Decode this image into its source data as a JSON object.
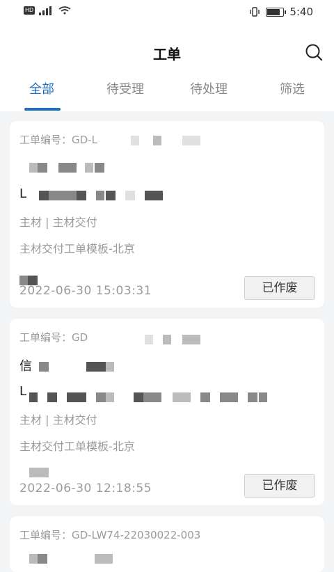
{
  "status_bar": {
    "network": "HD",
    "signal": "4G",
    "time": "5:40"
  },
  "header": {
    "title": "工单"
  },
  "tabs": [
    {
      "label": "全部",
      "active": true
    },
    {
      "label": "待受理",
      "active": false
    },
    {
      "label": "待处理",
      "active": false
    },
    {
      "label": "筛选",
      "active": false
    }
  ],
  "orders": [
    {
      "number": "工单编号：GD-L",
      "name": "",
      "address": "L",
      "category": "主材 | 主材交付",
      "template": "主材交付工单模板-北京",
      "time": "2022-06-30 15:03:31",
      "action": "已作废"
    },
    {
      "number": "工单编号：GD",
      "name": "信",
      "address": "L",
      "category": "主材 | 主材交付",
      "template": "主材交付工单模板-北京",
      "time": "2022-06-30 12:18:55",
      "action": "已作废"
    },
    {
      "number": "工单编号：GD-LW74-22030022-003"
    }
  ],
  "colors": {
    "accent": "#1f6fc0",
    "background": "#f3f4f6",
    "card": "#ffffff",
    "muted_text": "#9a9a9a"
  }
}
